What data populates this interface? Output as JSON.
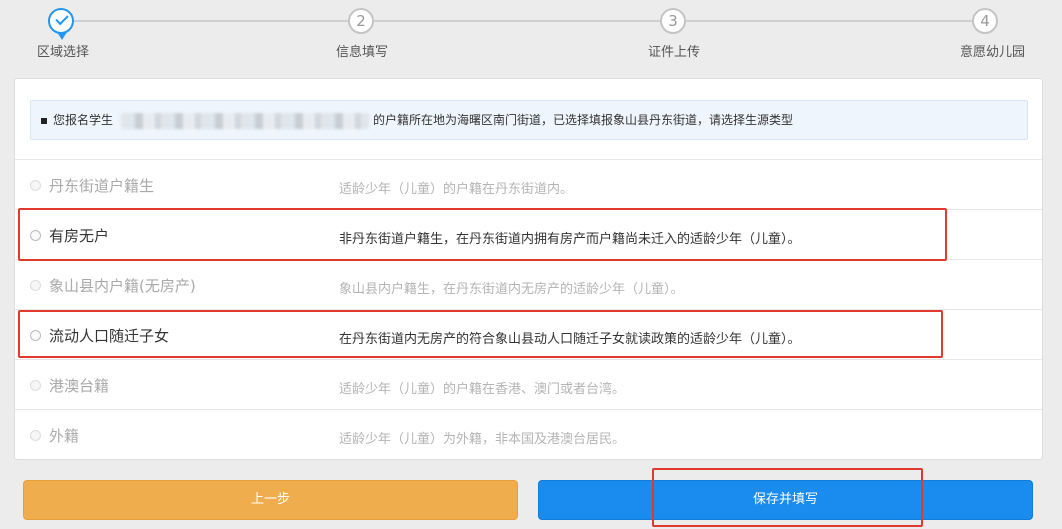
{
  "stepper": {
    "steps": [
      {
        "label": "区域选择",
        "number": "",
        "state": "done"
      },
      {
        "label": "信息填写",
        "number": "2",
        "state": "pending"
      },
      {
        "label": "证件上传",
        "number": "3",
        "state": "pending"
      },
      {
        "label": "意愿幼儿园",
        "number": "4",
        "state": "pending"
      }
    ]
  },
  "notice": {
    "prefix": "您报名学生",
    "suffix": "的户籍所在地为海曙区南门街道，已选择填报象山县丹东街道，请选择生源类型"
  },
  "options": [
    {
      "label": "丹东街道户籍生",
      "desc": "适龄少年（儿童）的户籍在丹东街道内。",
      "enabled": false
    },
    {
      "label": "有房无户",
      "desc": "非丹东街道户籍生，在丹东街道内拥有房产而户籍尚未迁入的适龄少年（儿童）。",
      "enabled": true
    },
    {
      "label": "象山县内户籍(无房产)",
      "desc": "象山县内户籍生，在丹东街道内无房产的适龄少年（儿童）。",
      "enabled": false
    },
    {
      "label": "流动人口随迁子女",
      "desc": "在丹东街道内无房产的符合象山县动人口随迁子女就读政策的适龄少年（儿童）。",
      "enabled": true
    },
    {
      "label": "港澳台籍",
      "desc": "适龄少年（儿童）的户籍在香港、澳门或者台湾。",
      "enabled": false
    },
    {
      "label": "外籍",
      "desc": "适龄少年（儿童）为外籍，非本国及港澳台居民。",
      "enabled": false
    }
  ],
  "buttons": {
    "prev_label": "上一步",
    "save_label": "保存并填写"
  },
  "colors": {
    "accent": "#1a8bef",
    "warning": "#f0ad4e",
    "highlight": "#e03a2f"
  }
}
